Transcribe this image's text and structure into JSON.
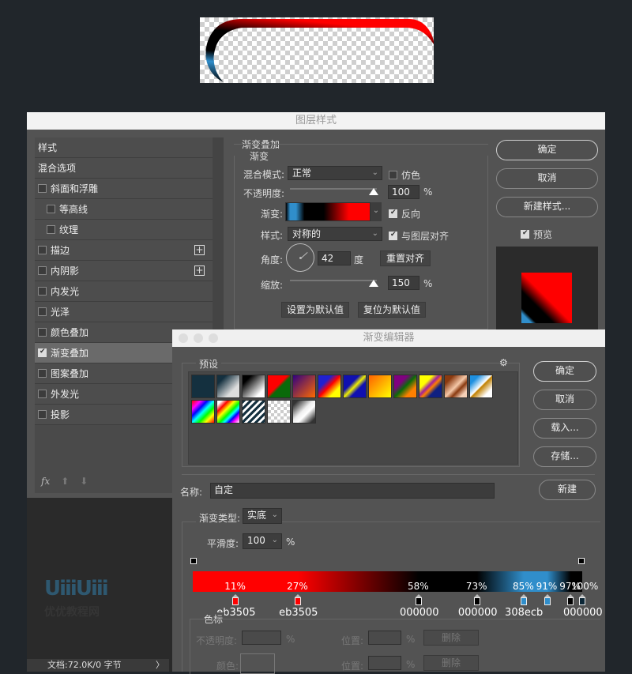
{
  "layer_style": {
    "title": "图层样式",
    "left_items": [
      {
        "label": "样式",
        "checkbox": false,
        "checked": false,
        "indent": false,
        "plus": false
      },
      {
        "label": "混合选项",
        "checkbox": false,
        "checked": false,
        "indent": false,
        "plus": false
      },
      {
        "label": "斜面和浮雕",
        "checkbox": true,
        "checked": false,
        "indent": false,
        "plus": false
      },
      {
        "label": "等高线",
        "checkbox": true,
        "checked": false,
        "indent": true,
        "plus": false
      },
      {
        "label": "纹理",
        "checkbox": true,
        "checked": false,
        "indent": true,
        "plus": false
      },
      {
        "label": "描边",
        "checkbox": true,
        "checked": false,
        "indent": false,
        "plus": true
      },
      {
        "label": "内阴影",
        "checkbox": true,
        "checked": false,
        "indent": false,
        "plus": true
      },
      {
        "label": "内发光",
        "checkbox": true,
        "checked": false,
        "indent": false,
        "plus": false
      },
      {
        "label": "光泽",
        "checkbox": true,
        "checked": false,
        "indent": false,
        "plus": false
      },
      {
        "label": "颜色叠加",
        "checkbox": true,
        "checked": false,
        "indent": false,
        "plus": false
      },
      {
        "label": "渐变叠加",
        "checkbox": true,
        "checked": true,
        "indent": false,
        "plus": false,
        "active": true
      },
      {
        "label": "图案叠加",
        "checkbox": true,
        "checked": false,
        "indent": false,
        "plus": false
      },
      {
        "label": "外发光",
        "checkbox": true,
        "checked": false,
        "indent": false,
        "plus": false
      },
      {
        "label": "投影",
        "checkbox": true,
        "checked": false,
        "indent": false,
        "plus": false
      }
    ],
    "footer": {
      "fx": "fx",
      "up": "⬆",
      "down": "⬇"
    },
    "status": "文档:72.0K/0 字节",
    "status_arrow": "〉",
    "watermark": "UiiiUiii",
    "watermark_sub": "优优教程网",
    "section_title": "渐变叠加",
    "group_title": "渐变",
    "blend_mode_label": "混合模式:",
    "blend_mode_value": "正常",
    "dither_label": "仿色",
    "opacity_label": "不透明度:",
    "opacity_value": "100",
    "percent": "%",
    "gradient_label": "渐变:",
    "reverse_label": "反向",
    "style_label": "样式:",
    "style_value": "对称的",
    "align_label": "与图层对齐",
    "angle_label": "角度:",
    "angle_value": "42",
    "degree": "度",
    "reset_align": "重置对齐",
    "scale_label": "缩放:",
    "scale_value": "150",
    "set_default": "设置为默认值",
    "reset_default": "复位为默认值",
    "ok": "确定",
    "cancel": "取消",
    "new_style": "新建样式...",
    "preview_label": "预览"
  },
  "gradient_editor": {
    "title": "渐变编辑器",
    "presets_label": "预设",
    "gear": "⚙",
    "ok": "确定",
    "cancel": "取消",
    "load": "载入...",
    "save": "存储...",
    "name_label": "名称:",
    "name_value": "自定",
    "new": "新建",
    "type_label": "渐变类型:",
    "type_value": "实底",
    "smooth_label": "平滑度:",
    "smooth_value": "100",
    "percent": "%",
    "stops_group": "色标",
    "opacity_label": "不透明度:",
    "position_label": "位置:",
    "delete_label": "删除",
    "color_label": "颜色:",
    "color_stops": [
      {
        "pct": "11%",
        "hex": "eb3505",
        "color": "#ff0000"
      },
      {
        "pct": "27%",
        "hex": "eb3505",
        "color": "#ff0000"
      },
      {
        "pct": "58%",
        "hex": "000000",
        "color": "#000000"
      },
      {
        "pct": "73%",
        "hex": "000000",
        "color": "#000000"
      },
      {
        "pct": "85%",
        "hex": "308ecb",
        "color": "#308ecb"
      },
      {
        "pct": "91%",
        "hex": "",
        "color": "#308ecb"
      },
      {
        "pct": "97%",
        "hex": "",
        "color": "#000000"
      },
      {
        "pct": "100%",
        "hex": "000000",
        "color": "#0b2636"
      }
    ]
  }
}
